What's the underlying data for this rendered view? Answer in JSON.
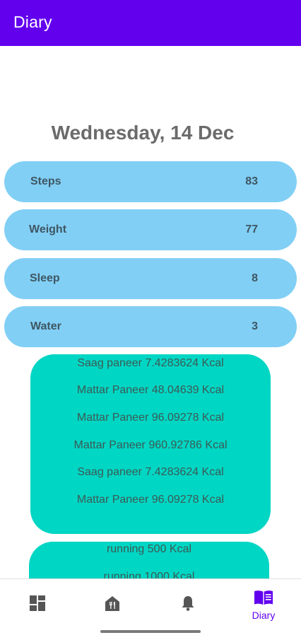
{
  "appbar": {
    "title": "Diary"
  },
  "date": "Wednesday, 14 Dec",
  "stats": [
    {
      "label": "Steps",
      "value": "83"
    },
    {
      "label": "Weight",
      "value": "77"
    },
    {
      "label": "Sleep",
      "value": "8"
    },
    {
      "label": "Water",
      "value": "3"
    }
  ],
  "food_entries": [
    "Saag paneer 7.4283624 Kcal",
    "Mattar Paneer 48.04639 Kcal",
    "Mattar Paneer 96.09278 Kcal",
    "Mattar Paneer 960.92786 Kcal",
    "Saag paneer 7.4283624 Kcal",
    "Mattar Paneer 96.09278 Kcal"
  ],
  "exercise_entries": [
    "running  500 Kcal",
    "running 1000 Kcal"
  ],
  "nav": {
    "items": [
      {
        "icon": "dashboard-icon",
        "label": ""
      },
      {
        "icon": "restaurant-icon",
        "label": ""
      },
      {
        "icon": "bell-icon",
        "label": ""
      },
      {
        "icon": "book-icon",
        "label": "Diary"
      }
    ],
    "active_color": "#6200ee",
    "inactive_color": "#555555"
  },
  "colors": {
    "appbar": "#6200ee",
    "stat_card": "#81cff5",
    "food_card": "#00d6c4"
  }
}
